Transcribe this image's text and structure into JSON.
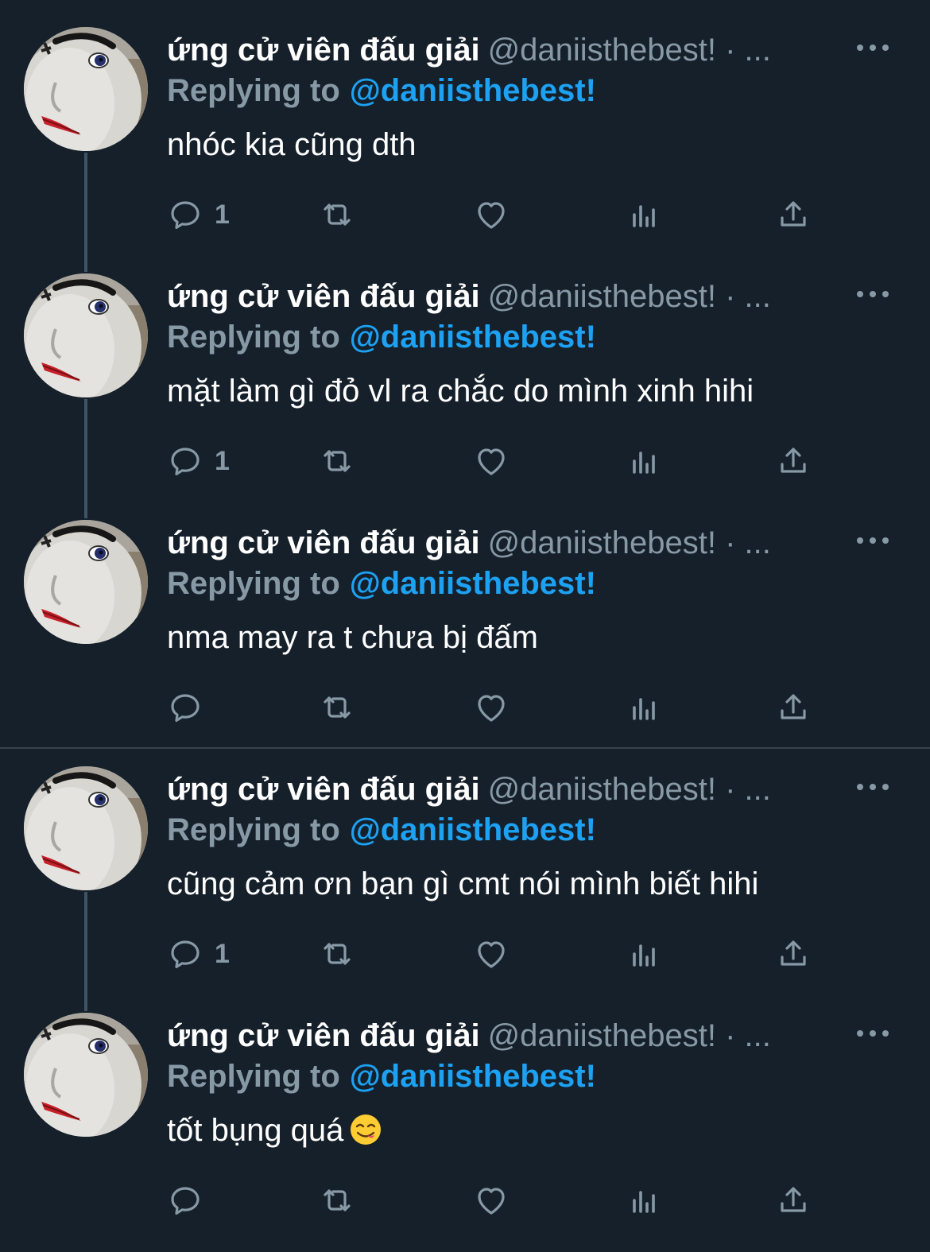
{
  "tweets": [
    {
      "name": "ứng cử viên đấu giải",
      "handle": "@daniisthebest! · ...",
      "replying_label": "Replying to",
      "replying_handle": "@daniisthebest!",
      "text": "nhóc kia cũng dth",
      "reply_count": "1",
      "has_emoji": false
    },
    {
      "name": "ứng cử viên đấu giải",
      "handle": "@daniisthebest! · ...",
      "replying_label": "Replying to",
      "replying_handle": "@daniisthebest!",
      "text": "mặt làm gì đỏ vl ra chắc do mình xinh hihi",
      "reply_count": "1",
      "has_emoji": false
    },
    {
      "name": "ứng cử viên đấu giải",
      "handle": "@daniisthebest! · ...",
      "replying_label": "Replying to",
      "replying_handle": "@daniisthebest!",
      "text": "nma may ra t chưa bị đấm",
      "reply_count": "",
      "has_emoji": false
    },
    {
      "name": "ứng cử viên đấu giải",
      "handle": "@daniisthebest! · ...",
      "replying_label": "Replying to",
      "replying_handle": "@daniisthebest!",
      "text": "cũng cảm ơn bạn gì cmt nói mình biết hihi",
      "reply_count": "1",
      "has_emoji": false
    },
    {
      "name": "ứng cử viên đấu giải",
      "handle": "@daniisthebest! · ...",
      "replying_label": "Replying to",
      "replying_handle": "@daniisthebest!",
      "text": "tốt bụng quá",
      "reply_count": "",
      "has_emoji": true,
      "emoji": "face-savoring-food-emoji"
    }
  ],
  "icons": {
    "reply": "reply-bubble-icon",
    "retweet": "retweet-icon",
    "like": "heart-icon",
    "analytics": "analytics-bars-icon",
    "share": "share-upload-icon",
    "more": "more-dots-icon"
  },
  "colors": {
    "background": "#15202b",
    "text": "#ffffff",
    "secondary": "#8899a6",
    "accent": "#1da1f2",
    "thread_line": "#3d5466",
    "divider": "#38444d"
  }
}
